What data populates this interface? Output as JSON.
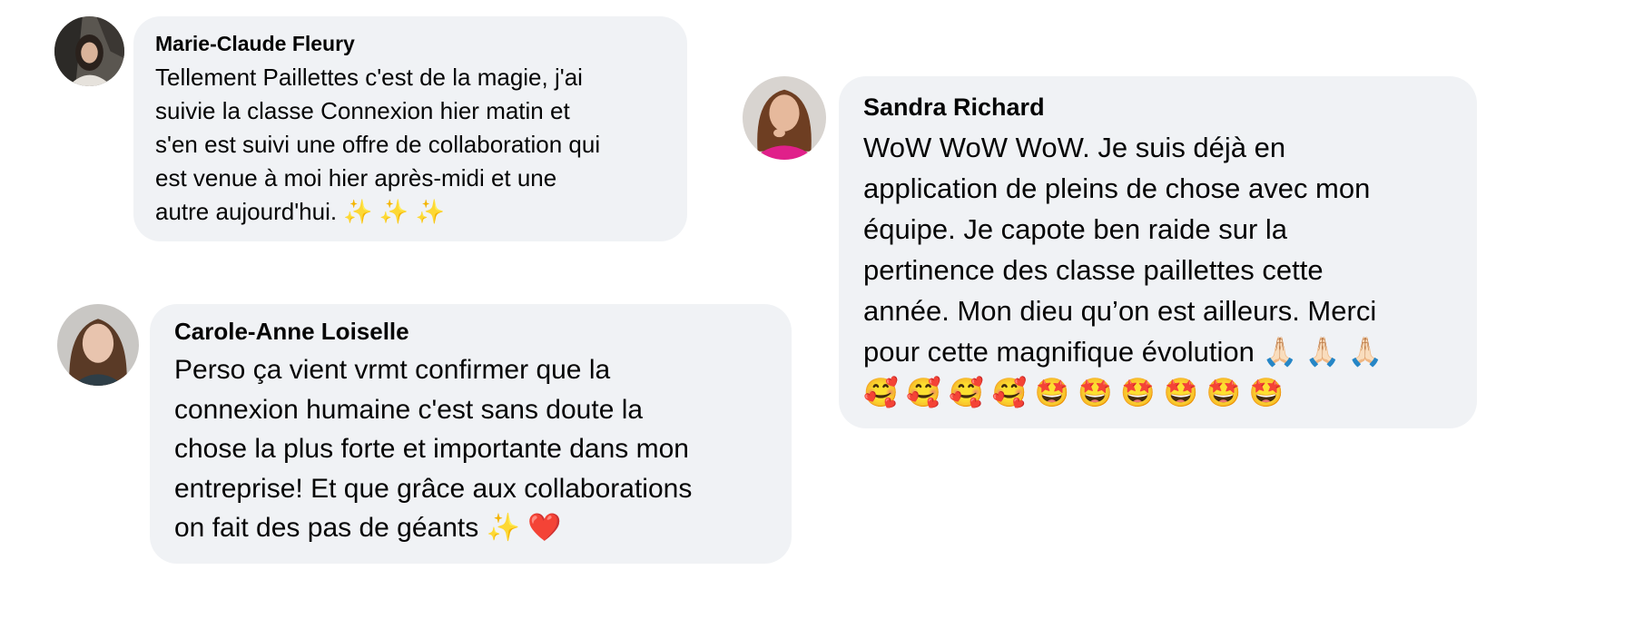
{
  "comments": [
    {
      "author": "Marie-Claude Fleury",
      "text": "Tellement Paillettes c'est de la magie, j'ai\nsuivie la classe Connexion hier matin et\ns'en est suivi une offre de collaboration qui\nest venue à moi hier après-midi et une\nautre aujourd'hui. ✨ ✨ ✨",
      "avatar_icon": "profile-photo-icon"
    },
    {
      "author": "Carole-Anne Loiselle",
      "text": "Perso ça vient vrmt confirmer que la\nconnexion humaine c'est sans doute la\nchose la plus forte et importante dans mon\nentreprise! Et que grâce aux collaborations\non fait des pas de géants ✨ ❤️",
      "avatar_icon": "profile-photo-icon"
    },
    {
      "author": "Sandra Richard",
      "text": "WoW WoW WoW. Je suis déjà en\napplication de pleins de chose avec mon\néquipe. Je capote ben raide sur la\npertinence des classe paillettes cette\nannée. Mon dieu qu’on est ailleurs. Merci\npour cette magnifique évolution 🙏🏻 🙏🏻 🙏🏻\n🥰 🥰 🥰 🥰 🤩 🤩 🤩 🤩 🤩 🤩",
      "avatar_icon": "profile-photo-icon"
    }
  ],
  "colors": {
    "bubble_bg": "#f0f2f5",
    "text": "#050505",
    "page_bg": "#ffffff"
  }
}
